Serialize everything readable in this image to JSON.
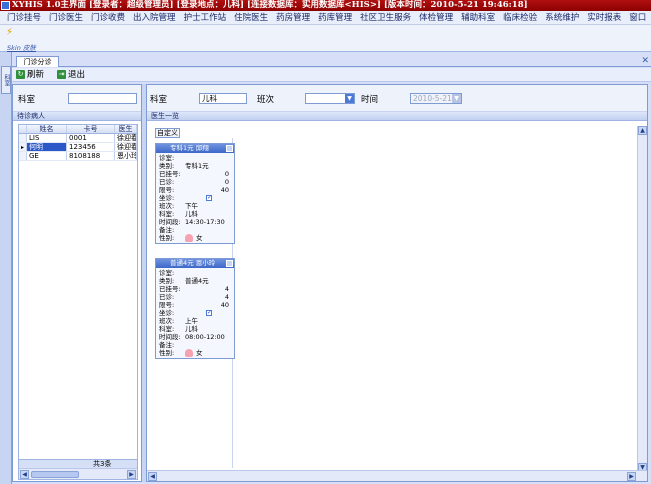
{
  "window": {
    "title": "XYHIS 1.0主界面  [登录者：超级管理员] [登录地点：儿科] [连接数据库：实用数据库<HIS>] [版本时间：2010-5-21 19:46:18]"
  },
  "menu": [
    "门诊挂号",
    "门诊医生",
    "门诊收费",
    "出入院管理",
    "护士工作站",
    "住院医生",
    "药房管理",
    "药库管理",
    "社区卫生服务",
    "体检管理",
    "辅助科室",
    "临床检验",
    "系统维护",
    "实时报表",
    "窗口"
  ],
  "skin": {
    "label": "Skin 皮肤"
  },
  "sidebar": {
    "tab_label": "科室"
  },
  "tab": {
    "label": "门诊分诊"
  },
  "toolbar": {
    "refresh_label": "刷新",
    "exit_label": "退出"
  },
  "left": {
    "dept_label": "科室",
    "dept_value": "",
    "group_title": "待诊病人",
    "columns": [
      "姓名",
      "卡号",
      "医生"
    ],
    "rows": [
      {
        "marker": "",
        "name": "LIS",
        "card": "0001",
        "doctor": "徐迎春"
      },
      {
        "marker": "▸",
        "name": "何明",
        "card": "123456",
        "doctor": "徐迎春"
      },
      {
        "marker": "",
        "name": "GE",
        "card": "8108188",
        "doctor": "恩小玲"
      }
    ],
    "count": "共3条"
  },
  "right": {
    "dept_label": "科室",
    "dept_value": "儿科",
    "shift_label": "班次",
    "shift_value": "",
    "time_label": "时间",
    "time_value": "2010-5-21",
    "group_title": "医生一览",
    "custom_button": "自定义"
  },
  "cards": [
    {
      "title": "专科1元 邱翔",
      "rows": [
        {
          "k": "诊室:",
          "v": ""
        },
        {
          "k": "类别:",
          "v": "专科1元"
        },
        {
          "k": "已挂号:",
          "vr": "0"
        },
        {
          "k": "已诊:",
          "vr": "0"
        },
        {
          "k": "限号:",
          "vr": "40"
        },
        {
          "k": "坐诊:",
          "check": "✓"
        },
        {
          "k": "班次:",
          "v": "下午"
        },
        {
          "k": "科室:",
          "v": "儿科"
        },
        {
          "k": "时间段:",
          "v": "14:30-17:30"
        },
        {
          "k": "备注:",
          "v": ""
        },
        {
          "k": "性别:",
          "gender": "女"
        }
      ]
    },
    {
      "title": "普通4元 恩小玲",
      "rows": [
        {
          "k": "诊室:",
          "v": ""
        },
        {
          "k": "类别:",
          "v": "普通4元"
        },
        {
          "k": "已挂号:",
          "vr": "4"
        },
        {
          "k": "已诊:",
          "vr": "4"
        },
        {
          "k": "限号:",
          "vr": "40"
        },
        {
          "k": "坐诊:",
          "check": "✓"
        },
        {
          "k": "班次:",
          "v": "上午"
        },
        {
          "k": "科室:",
          "v": "儿科"
        },
        {
          "k": "时间段:",
          "v": "08:00-12:00"
        },
        {
          "k": "备注:",
          "v": ""
        },
        {
          "k": "性别:",
          "gender": "女"
        }
      ]
    }
  ]
}
